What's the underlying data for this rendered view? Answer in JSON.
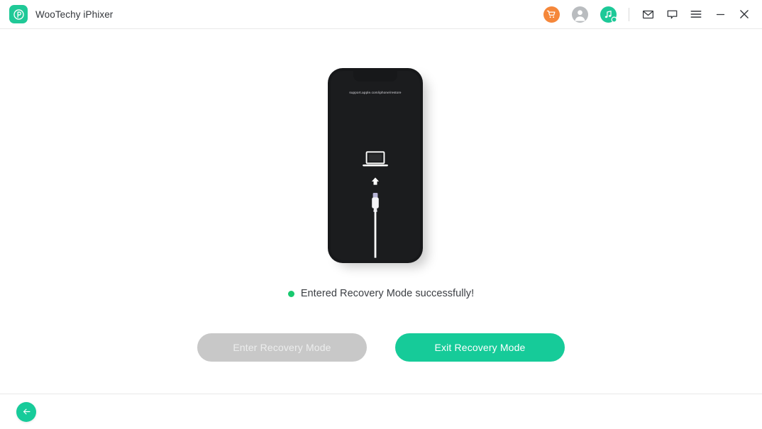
{
  "window": {
    "title": "WooTechy iPhixer",
    "logo_icon": "wootechy-p-logo-icon"
  },
  "titlebar": {
    "icons": [
      {
        "name": "shopping-cart-icon",
        "label": "Store",
        "color": "#f5873a"
      },
      {
        "name": "user-account-icon",
        "label": "Account",
        "color": "#b9bcbf"
      },
      {
        "name": "music-search-icon",
        "label": "Music Finder",
        "color": "#1dc998"
      },
      {
        "name": "mail-icon",
        "label": "Email Support",
        "color": "#33363b"
      },
      {
        "name": "feedback-icon",
        "label": "Feedback",
        "color": "#33363b"
      },
      {
        "name": "menu-icon",
        "label": "Menu",
        "color": "#33363b"
      },
      {
        "name": "minimize-icon",
        "label": "Minimize",
        "color": "#33363b"
      },
      {
        "name": "close-icon",
        "label": "Close",
        "color": "#33363b"
      }
    ]
  },
  "phone": {
    "restore_url": "support.apple.com/iphone/restore",
    "laptop_icon": "laptop-computer-icon",
    "arrow_icon": "up-arrow-icon",
    "cable_icon": "lightning-cable-icon",
    "screen_color": "#1b1c1e",
    "cable_tip_color": "#b6b4d6"
  },
  "status": {
    "message": "Entered Recovery Mode successfully!",
    "dot_color": "#18c96f"
  },
  "buttons": {
    "enter_recovery": {
      "label": "Enter Recovery Mode",
      "state": "disabled",
      "color": "#c8c8c8"
    },
    "exit_recovery": {
      "label": "Exit Recovery Mode",
      "state": "enabled",
      "color": "#16cb99"
    }
  },
  "footer": {
    "back_icon": "back-arrow-icon",
    "back_color": "#17cb9a"
  }
}
